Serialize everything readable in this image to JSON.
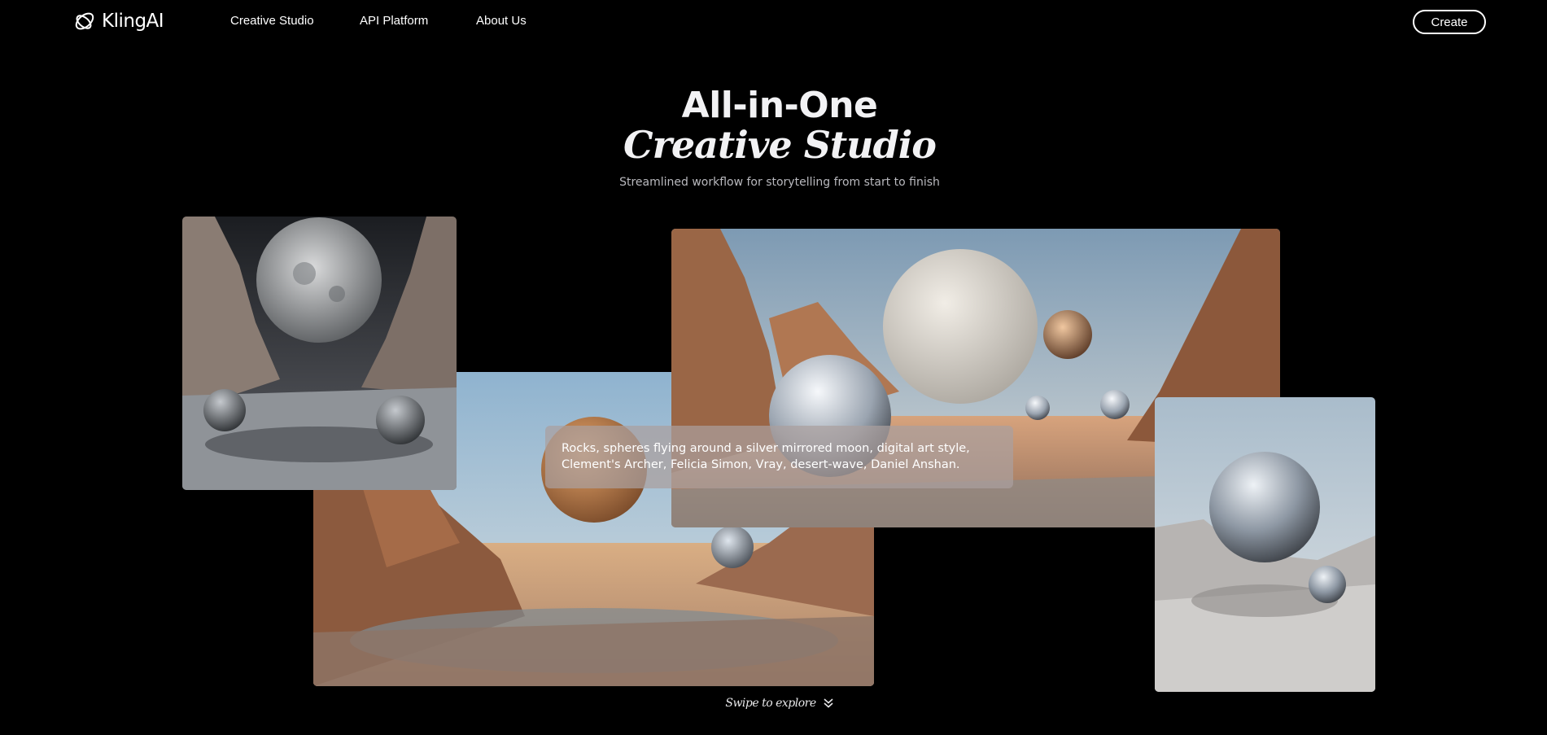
{
  "header": {
    "brand": "KlingAI",
    "nav": [
      "Creative Studio",
      "API Platform",
      "About Us"
    ],
    "create_label": "Create"
  },
  "hero": {
    "title_line1": "All-in-One",
    "title_line2": "Creative Studio",
    "subtitle": "Streamlined workflow for storytelling from start to finish"
  },
  "gallery": {
    "prompt": "Rocks, spheres flying around a silver mirrored moon, digital art style, Clement's Archer, Felicia Simon, Vray, desert-wave, Daniel Anshan.",
    "swipe_label": "Swipe to explore",
    "swipe_icon": "double-chevron-down-icon"
  },
  "colors": {
    "background": "#000000",
    "text": "#ffffff",
    "subtitle": "#b9b9be",
    "prompt_bg": "rgba(170,160,158,0.72)"
  }
}
